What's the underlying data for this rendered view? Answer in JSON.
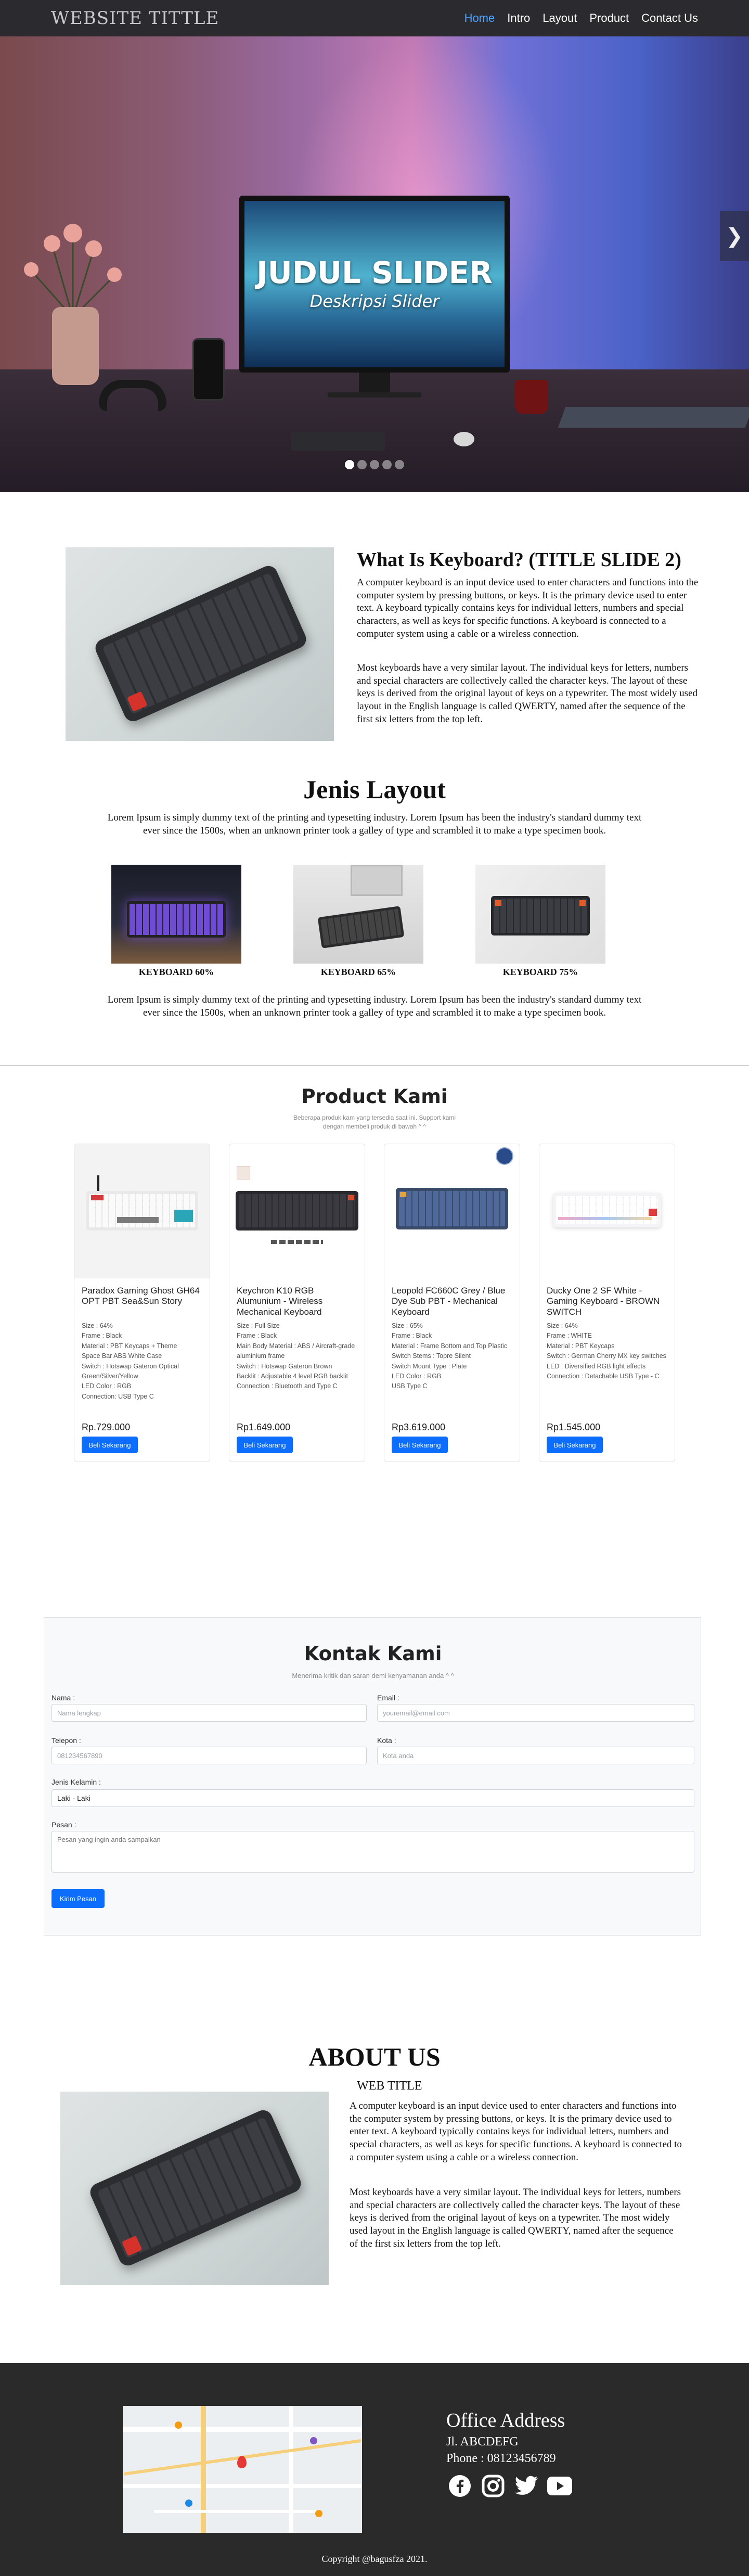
{
  "nav": {
    "brand": "WEBSITE TITTLE",
    "links": [
      "Home",
      "Intro",
      "Layout",
      "Product",
      "Contact Us"
    ]
  },
  "hero": {
    "title": "JUDUL SLIDER",
    "subtitle": "Deskripsi Slider",
    "slide_count": 5,
    "active_slide": 1
  },
  "intro": {
    "title": "What Is Keyboard? (TITLE SLIDE 2)",
    "p1": "A computer keyboard is an input device used to enter characters and functions into the computer system by pressing buttons, or keys. It is the primary device used to enter text. A keyboard typically contains keys for individual letters, numbers and special characters, as well as keys for specific functions. A keyboard is connected to a computer system using a cable or a wireless connection.",
    "p2": "Most keyboards have a very similar layout. The individual keys for letters, numbers and special characters are collectively called the character keys. The layout of these keys is derived from the original layout of keys on a typewriter. The most widely used layout in the English language is called QWERTY, named after the sequence of the first six letters from the top left."
  },
  "layouts": {
    "title": "Jenis Layout",
    "desc1": "Lorem Ipsum is simply dummy text of the printing and typesetting industry. Lorem Ipsum has been the industry's standard dummy text ever since the 1500s, when an unknown printer took a galley of type and scrambled it to make a type specimen book.",
    "desc2": "Lorem Ipsum is simply dummy text of the printing and typesetting industry. Lorem Ipsum has been the industry's standard dummy text ever since the 1500s, when an unknown printer took a galley of type and scrambled it to make a type specimen book.",
    "items": [
      {
        "label": "KEYBOARD 60%"
      },
      {
        "label": "KEYBOARD 65%"
      },
      {
        "label": "KEYBOARD 75%"
      }
    ]
  },
  "products": {
    "title": "Product Kami",
    "subtitle": "Beberapa produk kam yang tersedia saat ini. Support kami dengan membeli produk di bawah ^ ^",
    "buy_label": "Beli Sekarang",
    "items": [
      {
        "name": "Paradox Gaming Ghost GH64 OPT PBT Sea&Sun Story",
        "specs": [
          "Size : 64%",
          "Frame : Black",
          "Material : PBT Keycaps + Theme",
          "Space Bar ABS White Case",
          "Switch : Hotswap Gateron Optical Green/Silver/Yellow",
          "LED Color : RGB",
          "Connection: USB Type C"
        ],
        "price": "Rp.729.000"
      },
      {
        "name": "Keychron K10 RGB Alumunium - Wireless Mechanical Keyboard",
        "specs": [
          "Size : Full Size",
          "Frame : Black",
          "Main Body Material : ABS / Aircraft-grade aluminium frame",
          "Switch : Hotswap Gateron Brown",
          "Backlit : Adjustable 4 level RGB backlit",
          "Connection : Bluetooth and Type C"
        ],
        "price": "Rp1.649.000"
      },
      {
        "name": "Leopold FC660C Grey / Blue Dye Sub PBT - Mechanical Keyboard",
        "specs": [
          "Size : 65%",
          "Frame : Black",
          "Material : Frame Bottom and Top Plastic",
          "Switch Stems : Topre Silent",
          "Switch Mount Type : Plate",
          "LED Color : RGB",
          "USB Type C"
        ],
        "price": "Rp3.619.000"
      },
      {
        "name": "Ducky One 2 SF White - Gaming Keyboard - BROWN SWITCH",
        "specs": [
          "Size : 64%",
          "Frame : WHITE",
          "Material : PBT Keycaps",
          "Switch : German Cherry MX key switches",
          "LED : Diversified RGB light effects",
          "Connection : Detachable USB Type - C"
        ],
        "price": "Rp1.545.000"
      }
    ]
  },
  "contact": {
    "title": "Kontak Kami",
    "subtitle": "Menerima kritik dan saran demi kenyamanan anda ^ ^",
    "name_label": "Nama :",
    "name_placeholder": "Nama lengkap",
    "email_label": "Email :",
    "email_placeholder": "youremail@email.com",
    "phone_label": "Telepon :",
    "phone_placeholder": "081234567890",
    "city_label": "Kota :",
    "city_placeholder": "Kota anda",
    "gender_label": "Jenis Kelamin :",
    "gender_value": "Laki - Laki",
    "message_label": "Pesan :",
    "message_placeholder": "Pesan yang ingin anda sampaikan",
    "submit_label": "Kirim Pesan"
  },
  "about": {
    "title": "ABOUT US",
    "subtitle": "WEB TITLE",
    "p1": "A computer keyboard is an input device used to enter characters and functions into the computer system by pressing buttons, or keys. It is the primary device used to enter text. A keyboard typically contains keys for individual letters, numbers and special characters, as well as keys for specific functions. A keyboard is connected to a computer system using a cable or a wireless connection.",
    "p2": "Most keyboards have a very similar layout. The individual keys for letters, numbers and special characters are collectively called the character keys. The layout of these keys is derived from the original layout of keys on a typewriter. The most widely used layout in the English language is called QWERTY, named after the sequence of the first six letters from the top left."
  },
  "footer": {
    "office_title": "Office Address",
    "address": "Jl. ABCDEFG",
    "phone": "Phone : 08123456789",
    "social_icons": [
      "facebook-icon",
      "instagram-icon",
      "twitter-icon",
      "youtube-icon"
    ],
    "copyright": "Copyright @bagusfza 2021."
  },
  "colors": {
    "navbar": "#2b2b2f",
    "accent_blue": "#0d6efd",
    "nav_active": "#4ea3ff",
    "footer": "#2a2a2a"
  }
}
